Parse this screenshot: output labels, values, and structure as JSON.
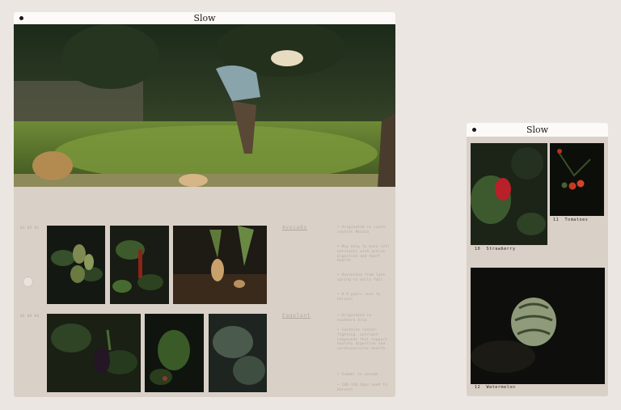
{
  "main_window": {
    "title": "Slow",
    "row1": {
      "date": "01 05 01",
      "name": "Avocado",
      "notes": [
        "• Originated in south-central Mexico",
        "• May help to more (of) nutrients with active digestion and heart health",
        "• Harvested from late spring to early fall",
        "• 8-9 years rest to harvest"
      ]
    },
    "row2": {
      "date": "08 08 08",
      "name": "Eggplant",
      "notes": [
        "• Originated in southern Asia",
        "• Contains cancer-fighting, nutrient compounds that support healthy digestion and cardiovascular health",
        "• Summer to autumn",
        "• 100-120 days seed to harvest"
      ]
    }
  },
  "side_window": {
    "title": "Slow",
    "items": [
      {
        "num": "10",
        "name": "Strawberry"
      },
      {
        "num": "11",
        "name": "Tomatoes"
      },
      {
        "num": "12",
        "name": "Watermelon"
      }
    ]
  },
  "colors": {
    "background": "#ebe6e1",
    "panel": "#d9d0c7",
    "titlebar": "#fbfaf8",
    "muted_text": "#b3a79c"
  }
}
